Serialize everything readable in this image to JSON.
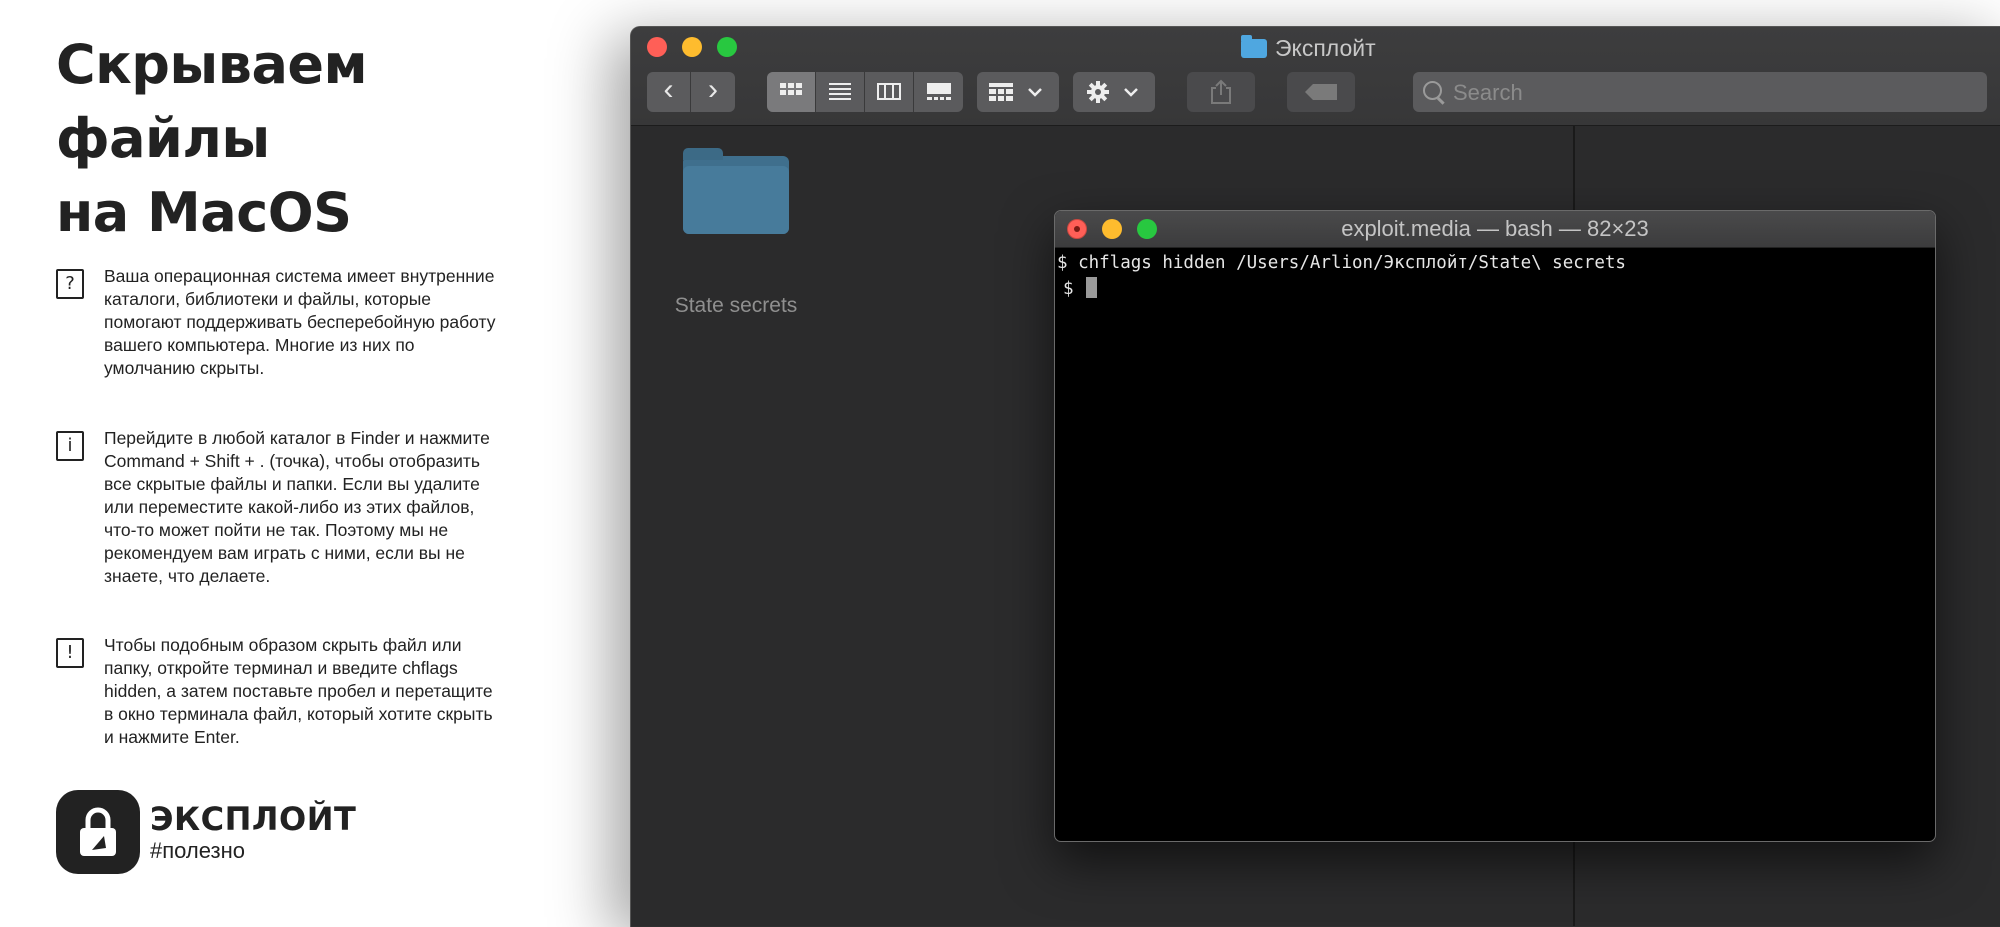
{
  "headline": {
    "line1": "Скрываем",
    "line2": "файлы",
    "line3": "на MacOS"
  },
  "tips": [
    {
      "icon": "question-icon",
      "glyph": "?",
      "text": "Ваша операционная система имеет внутренние каталоги, библиотеки и файлы, которые помогают поддерживать бесперебойную работу вашего компьютера. Многие из них по умолчанию скрыты."
    },
    {
      "icon": "info-icon",
      "glyph": "i",
      "text": "Перейдите в любой каталог в Finder и нажмите Command + Shift + . (точка), чтобы отобразить все скрытые файлы и папки. Если вы удалите или переместите какой-либо из этих файлов, что-то может пойти не так. Поэтому мы не рекомендуем вам играть с ними, если вы не знаете, что делаете."
    },
    {
      "icon": "exclamation-icon",
      "glyph": "!",
      "text": "Чтобы подобным образом скрыть файл или папку, откройте терминал и введите chflags hidden, а затем поставьте пробел и перетащите в окно терминала файл, который хотите скрыть и нажмите Enter."
    }
  ],
  "brand": {
    "name": "ЭКСПЛОЙТ",
    "tag": "#полезно"
  },
  "finder": {
    "title": "Эксплойт",
    "search_placeholder": "Search",
    "folder_label": "State secrets",
    "toolbar": {
      "back": "‹",
      "forward": "›",
      "views": [
        "icon-view",
        "list-view",
        "column-view",
        "gallery-view"
      ]
    }
  },
  "terminal": {
    "title": "exploit.media — bash — 82×23",
    "line1": "$ chflags hidden /Users/Arlion/Эксплойт/State\\ secrets",
    "prompt": "$ "
  },
  "colors": {
    "close": "#ff5f57",
    "minimize": "#febc2e",
    "zoom": "#28c840",
    "folder": "#4fa7e0",
    "finder_bg": "#2b2b2c"
  }
}
